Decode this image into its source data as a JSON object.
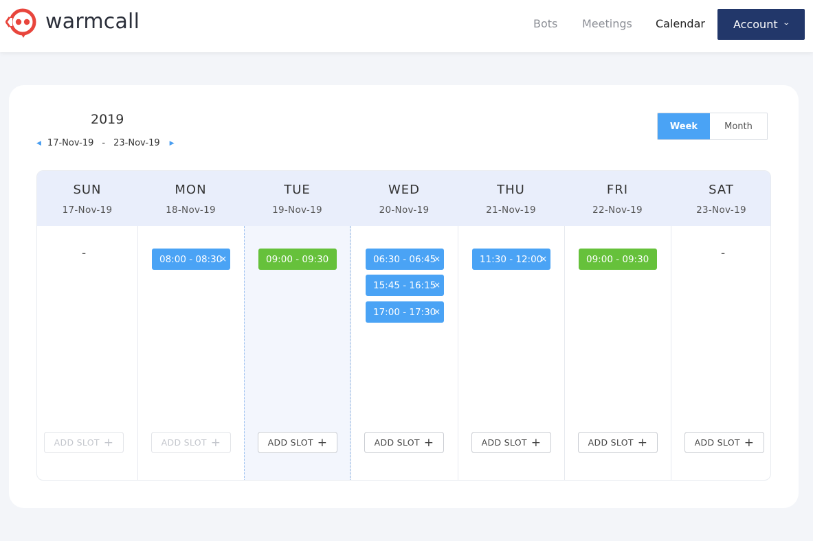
{
  "brand": {
    "name": "warmcall",
    "primary_color": "#e8453c",
    "accent_color": "#22376a"
  },
  "nav": {
    "items": [
      {
        "label": "Bots",
        "active": false
      },
      {
        "label": "Meetings",
        "active": false
      },
      {
        "label": "Calendar",
        "active": true
      }
    ],
    "account_label": "Account"
  },
  "calendar": {
    "year": "2019",
    "range_start": "17-Nov-19",
    "range_sep": "-",
    "range_end": "23-Nov-19",
    "views": {
      "week": "Week",
      "month": "Month",
      "selected": "Week"
    },
    "add_slot_label": "ADD SLOT",
    "empty_marker": "-",
    "days": [
      {
        "name": "SUN",
        "date": "17-Nov-19",
        "slots": [],
        "add_enabled": false
      },
      {
        "name": "MON",
        "date": "18-Nov-19",
        "slots": [
          {
            "time": "08:00 - 08:30",
            "color": "blue",
            "removable": true
          }
        ],
        "add_enabled": false
      },
      {
        "name": "TUE",
        "date": "19-Nov-19",
        "today": true,
        "slots": [
          {
            "time": "09:00 - 09:30",
            "color": "green",
            "removable": false
          }
        ],
        "add_enabled": true
      },
      {
        "name": "WED",
        "date": "20-Nov-19",
        "slots": [
          {
            "time": "06:30 - 06:45",
            "color": "blue",
            "removable": true
          },
          {
            "time": "15:45 - 16:15",
            "color": "blue",
            "removable": true
          },
          {
            "time": "17:00 - 17:30",
            "color": "blue",
            "removable": true
          }
        ],
        "add_enabled": true
      },
      {
        "name": "THU",
        "date": "21-Nov-19",
        "slots": [
          {
            "time": "11:30 - 12:00",
            "color": "blue",
            "removable": true
          }
        ],
        "add_enabled": true
      },
      {
        "name": "FRI",
        "date": "22-Nov-19",
        "slots": [
          {
            "time": "09:00 - 09:30",
            "color": "green",
            "removable": false
          }
        ],
        "add_enabled": true
      },
      {
        "name": "SAT",
        "date": "23-Nov-19",
        "slots": [],
        "add_enabled": true
      }
    ],
    "slot_colors": {
      "blue": "#4aa3f5",
      "green": "#66c13b"
    },
    "remove_glyph": "×",
    "add_glyph": "+"
  }
}
